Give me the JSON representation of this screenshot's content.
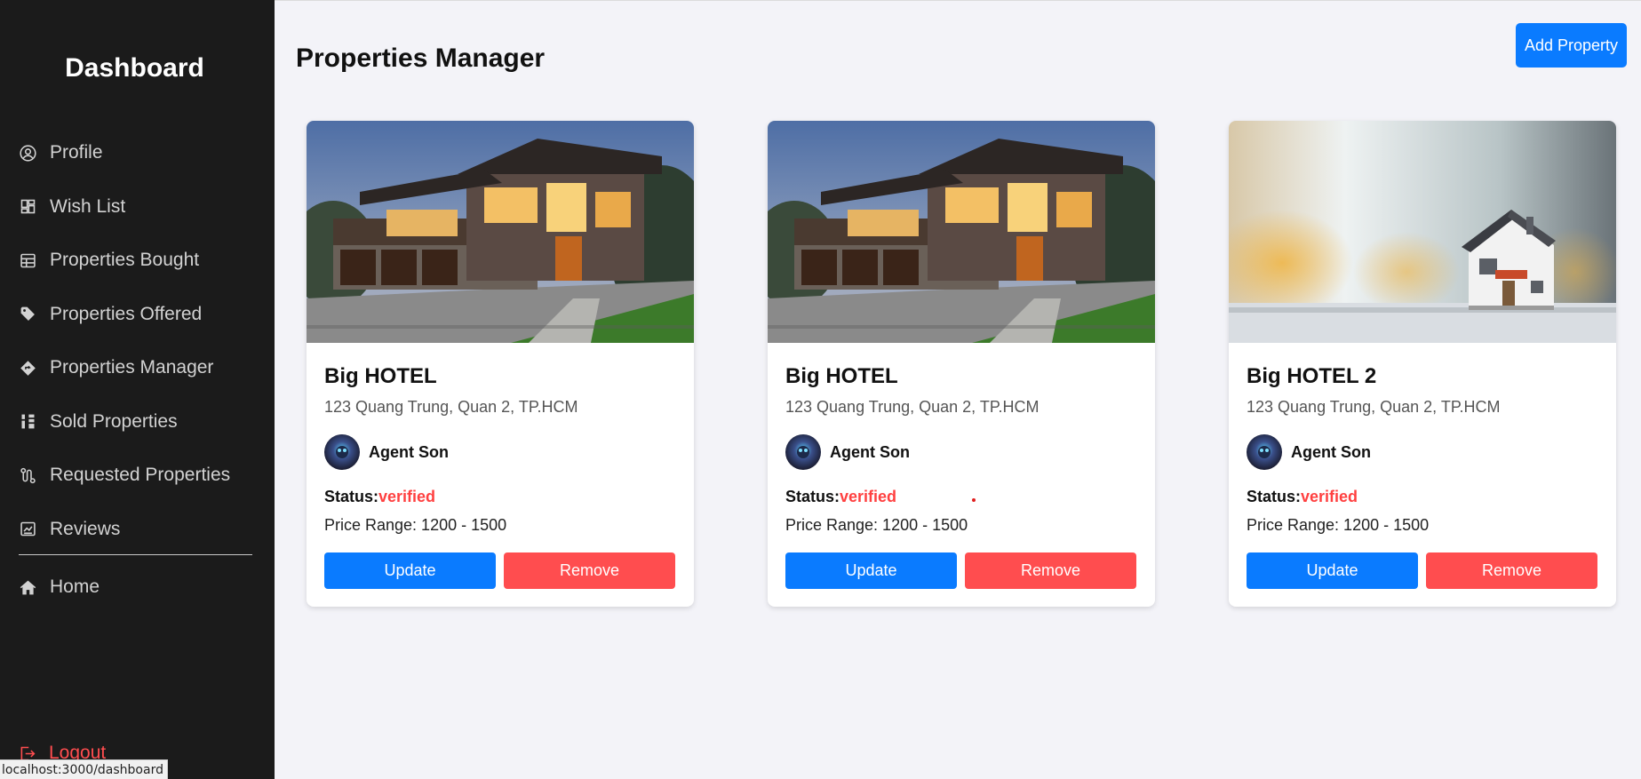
{
  "sidebar": {
    "brand": "Dashboard",
    "items": [
      {
        "label": "Profile",
        "icon": "user-circle-icon"
      },
      {
        "label": "Wish List",
        "icon": "dashboard-grid-icon"
      },
      {
        "label": "Properties Bought",
        "icon": "table-icon"
      },
      {
        "label": "Properties Offered",
        "icon": "tag-icon"
      },
      {
        "label": "Properties Manager",
        "icon": "diamond-icon"
      },
      {
        "label": "Sold Properties",
        "icon": "sort-icon"
      },
      {
        "label": "Requested Properties",
        "icon": "route-icon"
      },
      {
        "label": "Reviews",
        "icon": "chart-box-icon"
      }
    ],
    "home": {
      "label": "Home",
      "icon": "home-icon"
    },
    "logout": {
      "label": "Logout",
      "icon": "logout-icon"
    }
  },
  "status_bar": {
    "url": "localhost:3000/dashboard"
  },
  "main": {
    "title": "Properties Manager",
    "add_button": "Add Property",
    "cards": [
      {
        "title": "Big HOTEL",
        "address": "123 Quang Trung, Quan 2, TP.HCM",
        "agent": "Agent Son",
        "status_label": "Status:",
        "status": "verified",
        "price": "Price Range: 1200 - 1500",
        "update": "Update",
        "remove": "Remove",
        "image": "modern-house-photo"
      },
      {
        "title": "Big HOTEL",
        "address": "123 Quang Trung, Quan 2, TP.HCM",
        "agent": "Agent Son",
        "status_label": "Status:",
        "status": "verified",
        "price": "Price Range: 1200 - 1500",
        "update": "Update",
        "remove": "Remove",
        "image": "modern-house-photo"
      },
      {
        "title": "Big HOTEL 2",
        "address": "123 Quang Trung, Quan 2, TP.HCM",
        "agent": "Agent Son",
        "status_label": "Status:",
        "status": "verified",
        "price": "Price Range: 1200 - 1500",
        "update": "Update",
        "remove": "Remove",
        "image": "miniature-house-photo"
      }
    ]
  },
  "colors": {
    "accent": "#0a7bff",
    "danger": "#ff4d4f",
    "sidebar_bg": "#1b1b1b",
    "page_bg": "#f3f3f8"
  }
}
